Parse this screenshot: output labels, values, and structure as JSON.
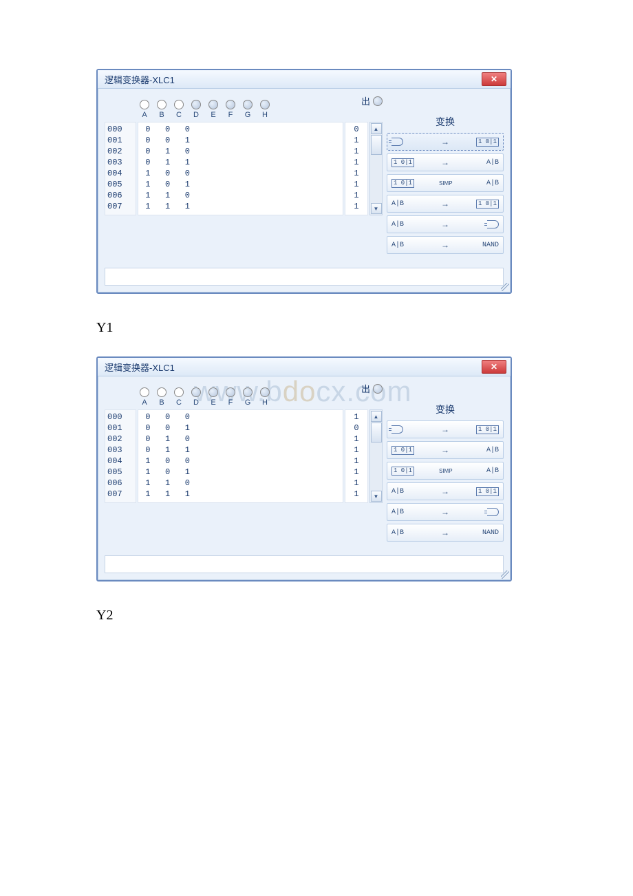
{
  "captions": {
    "y1": "Y1",
    "y2": "Y2"
  },
  "watermark": "www.bdocx.com",
  "window_title": "逻辑变换器-XLC1",
  "close_glyph": "✕",
  "out_label": "出",
  "convert_label": "变换",
  "input_labels": [
    "A",
    "B",
    "C",
    "D",
    "E",
    "F",
    "G",
    "H"
  ],
  "table1": {
    "idx": [
      "000",
      "001",
      "002",
      "003",
      "004",
      "005",
      "006",
      "007"
    ],
    "rows": [
      [
        "0",
        "0",
        "0"
      ],
      [
        "0",
        "0",
        "1"
      ],
      [
        "0",
        "1",
        "0"
      ],
      [
        "0",
        "1",
        "1"
      ],
      [
        "1",
        "0",
        "0"
      ],
      [
        "1",
        "0",
        "1"
      ],
      [
        "1",
        "1",
        "0"
      ],
      [
        "1",
        "1",
        "1"
      ]
    ],
    "out": [
      "0",
      "1",
      "1",
      "1",
      "1",
      "1",
      "1",
      "1"
    ]
  },
  "table2": {
    "idx": [
      "000",
      "001",
      "002",
      "003",
      "004",
      "005",
      "006",
      "007"
    ],
    "rows": [
      [
        "0",
        "0",
        "0"
      ],
      [
        "0",
        "0",
        "1"
      ],
      [
        "0",
        "1",
        "0"
      ],
      [
        "0",
        "1",
        "1"
      ],
      [
        "1",
        "0",
        "0"
      ],
      [
        "1",
        "0",
        "1"
      ],
      [
        "1",
        "1",
        "0"
      ],
      [
        "1",
        "1",
        "1"
      ]
    ],
    "out": [
      "1",
      "0",
      "1",
      "1",
      "1",
      "1",
      "1",
      "1"
    ]
  },
  "buttons": {
    "tt": "1 0|1",
    "ab": "A|B",
    "simp": "SIMP",
    "nand": "NAND",
    "arrow": "→"
  }
}
